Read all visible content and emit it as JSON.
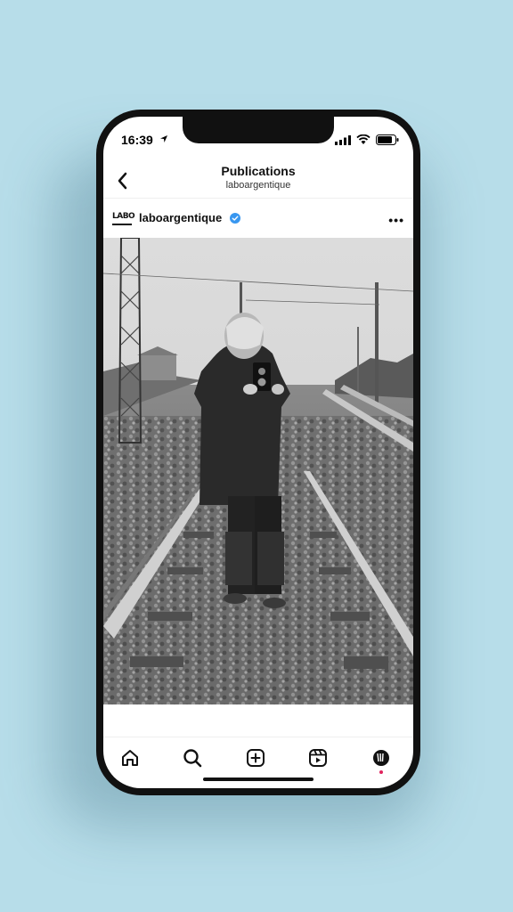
{
  "status_bar": {
    "time": "16:39"
  },
  "header": {
    "title": "Publications",
    "subtitle": "laboargentique"
  },
  "post": {
    "avatar_text": "LABO",
    "username": "laboargentique",
    "verified": true,
    "photo_description_icon": "photo"
  },
  "tabbar": {
    "items": [
      "home-icon",
      "search-icon",
      "create-icon",
      "reels-icon",
      "profile-icon"
    ]
  },
  "colors": {
    "background": "#b7dde9",
    "verified": "#3897f0",
    "notification": "#e0245e"
  }
}
